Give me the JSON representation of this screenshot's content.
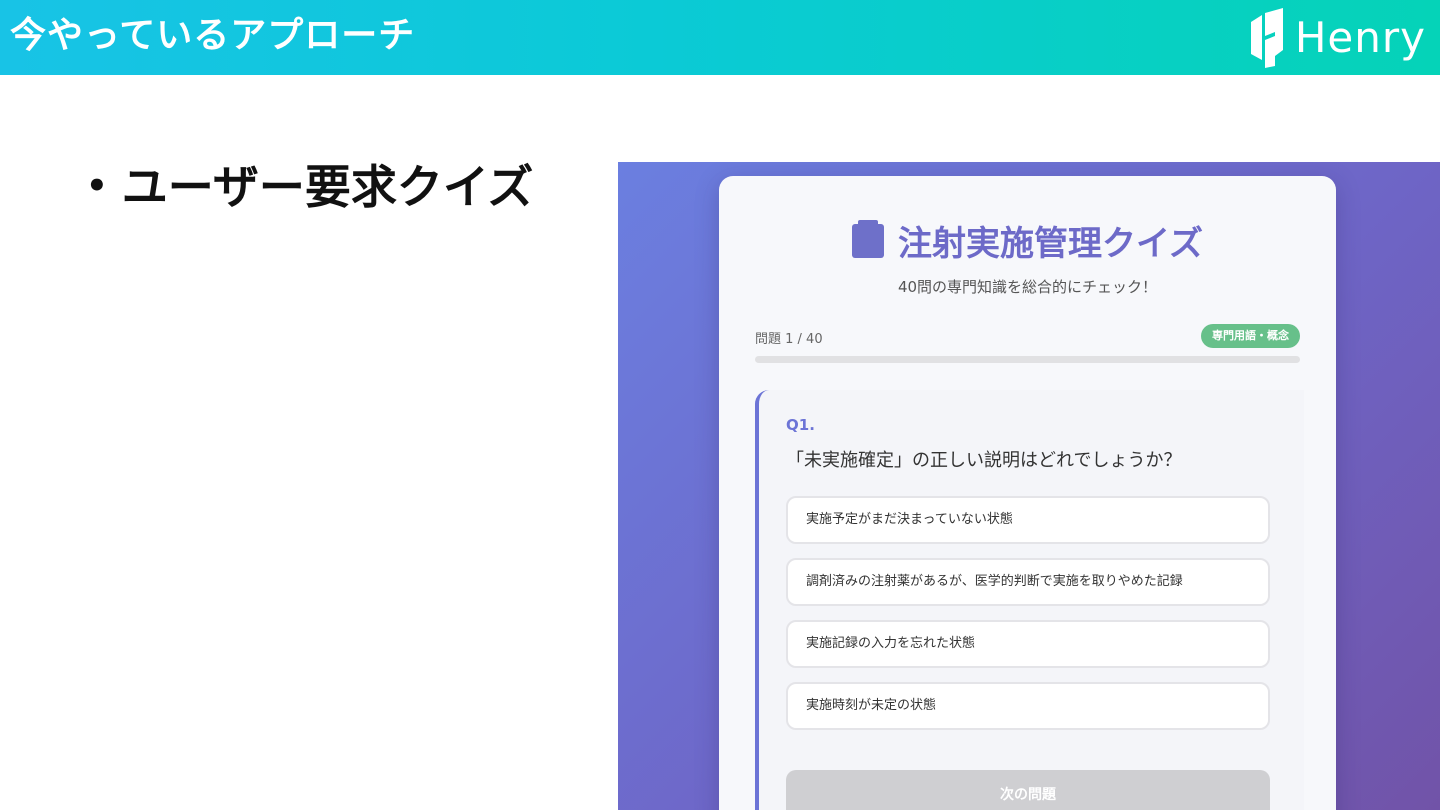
{
  "slide": {
    "header_title": "今やっているアプローチ",
    "logo_text": "Henry",
    "bullet_text": "ユーザー要求クイズ",
    "bullet_symbol": "•"
  },
  "quiz": {
    "title": "注射実施管理クイズ",
    "subtitle": "40問の専門知識を総合的にチェック！",
    "progress_label": "問題 1 / 40",
    "progress_fraction": 0.0,
    "category_badge": "専門用語・概念",
    "question_number": "Q1.",
    "question_text": "「未実施確定」の正しい説明はどれでしょうか？",
    "options": [
      "実施予定がまだ決まっていない状態",
      "調剤済みの注射薬があるが、医学的判断で実施を取りやめた記録",
      "実施記録の入力を忘れた状態",
      "実施時刻が未定の状態"
    ],
    "next_button_label": "次の問題"
  },
  "colors": {
    "header_gradient_start": "#18c3e6",
    "header_gradient_end": "#05d3b8",
    "quiz_background_start": "#6b7fe0",
    "quiz_background_end": "#7153a8",
    "accent": "#6c74d6",
    "badge_green": "#67c08a",
    "disabled_button": "#cfcfd2"
  },
  "icons": {
    "quiz_title_icon": "book-icon",
    "logo_mark": "henry-logo-icon"
  }
}
